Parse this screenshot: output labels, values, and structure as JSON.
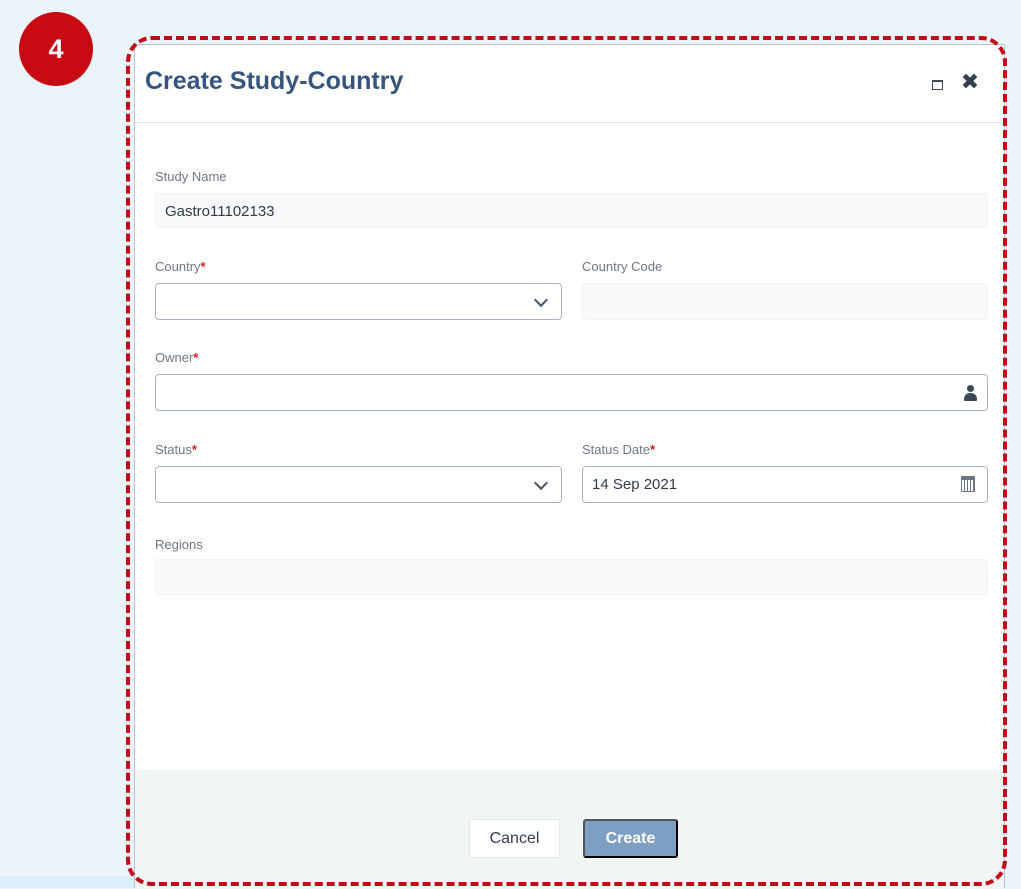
{
  "step_badge": "4",
  "dialog": {
    "title": "Create Study-Country",
    "maximize_icon": "maximize-icon",
    "close_icon": "close-icon"
  },
  "form": {
    "study_name": {
      "label": "Study Name",
      "value": "Gastro11102133"
    },
    "country": {
      "label": "Country",
      "required_mark": "*",
      "value": ""
    },
    "country_code": {
      "label": "Country Code",
      "value": ""
    },
    "owner": {
      "label": "Owner",
      "required_mark": "*",
      "value": ""
    },
    "status": {
      "label": "Status",
      "required_mark": "*",
      "value": ""
    },
    "status_date": {
      "label": "Status Date",
      "required_mark": "*",
      "value": "14 Sep 2021"
    },
    "regions": {
      "label": "Regions",
      "value": ""
    }
  },
  "footer": {
    "cancel_label": "Cancel",
    "create_label": "Create"
  },
  "colors": {
    "accent_title": "#35557f",
    "highlight": "#c00d17",
    "required": "#d71920",
    "create_button": "#7c9fc3"
  }
}
